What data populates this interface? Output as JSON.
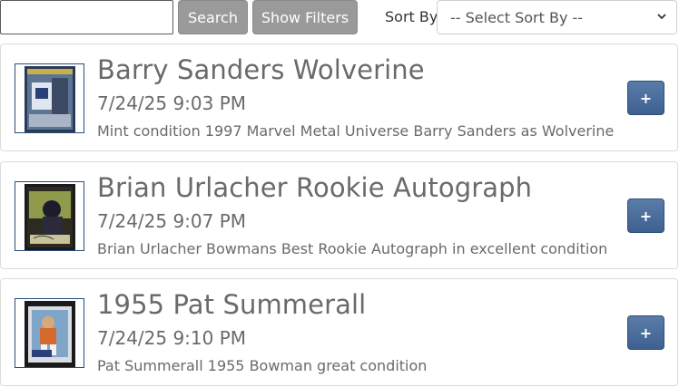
{
  "toolbar": {
    "search_value": "",
    "search_label": "Search",
    "show_filters_label": "Show Filters",
    "sort_by_label": "Sort By",
    "sort_selected": "-- Select Sort By --"
  },
  "items": [
    {
      "title": "Barry Sanders Wolverine",
      "datetime": "7/24/25 9:03 PM",
      "description": "Mint condition 1997 Marvel Metal Universe Barry Sanders as Wolverine",
      "add_label": "+"
    },
    {
      "title": "Brian Urlacher Rookie Autograph",
      "datetime": "7/24/25 9:07 PM",
      "description": "Brian Urlacher Bowmans Best Rookie Autograph in excellent condition",
      "add_label": "+"
    },
    {
      "title": "1955 Pat Summerall",
      "datetime": "7/24/25 9:10 PM",
      "description": "Pat Summerall 1955 Bowman great condition",
      "add_label": "+"
    }
  ],
  "colors": {
    "add_button": "#4a6c9b",
    "gray_button": "#9a9a9a",
    "thumb_border": "#2b4d7a"
  }
}
